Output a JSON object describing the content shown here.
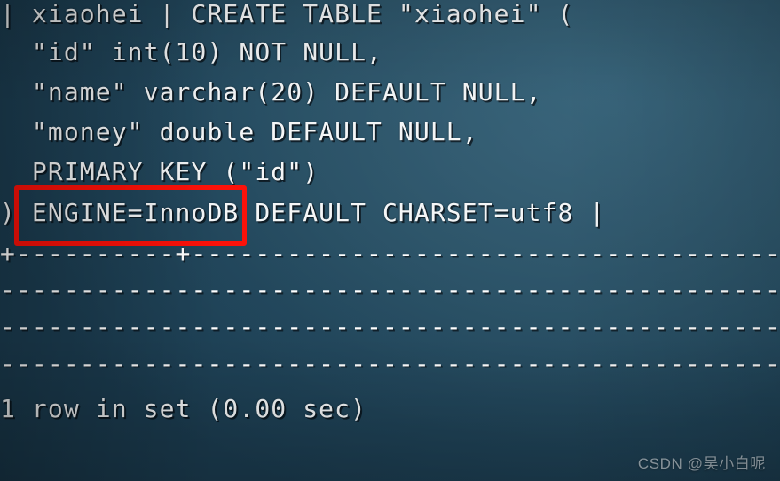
{
  "terminal": {
    "lines": [
      "| xiaohei | CREATE TABLE \"xiaohei\" (",
      "  \"id\" int(10) NOT NULL,",
      "  \"name\" varchar(20) DEFAULT NULL,",
      "  \"money\" double DEFAULT NULL,",
      "  PRIMARY KEY (\"id\")",
      ") ENGINE=InnoDB DEFAULT CHARSET=utf8 |"
    ],
    "separators": [
      "+----------+-------------------------------------------------------------",
      "--------------------------------------------------------------------------",
      "--------------------------------------------------------------------------",
      "-----------------------------------------------------------------+"
    ],
    "result_status": "1 row in set (0.00 sec)"
  },
  "annotation": {
    "highlight_label": "ENGINE=InnoDB"
  },
  "watermark": {
    "text": "CSDN @吴小白呢"
  },
  "colors": {
    "background_dark": "#1b3c50",
    "background_light": "#336178",
    "text": "#f4f6f7",
    "highlight": "#fc1008"
  }
}
